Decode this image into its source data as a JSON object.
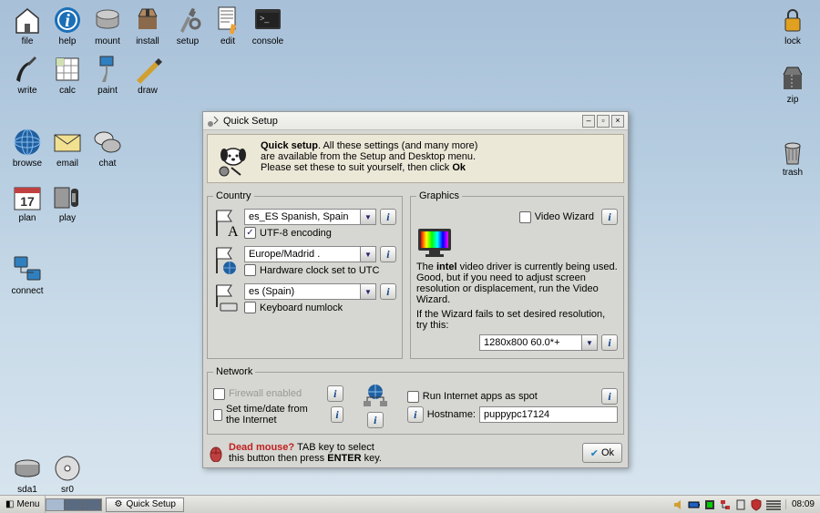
{
  "desktop_icons": {
    "file": "file",
    "help": "help",
    "mount": "mount",
    "install": "install",
    "setup": "setup",
    "edit": "edit",
    "console": "console",
    "write": "write",
    "calc": "calc",
    "paint": "paint",
    "draw": "draw",
    "browse": "browse",
    "email": "email",
    "chat": "chat",
    "plan": "plan",
    "play": "play",
    "connect": "connect",
    "lock": "lock",
    "zip": "zip",
    "trash": "trash",
    "sda1": "sda1",
    "sr0": "sr0"
  },
  "window": {
    "title": "Quick Setup",
    "banner": {
      "line1_bold": "Quick setup",
      "line1_rest": ". All these settings (and many more)",
      "line2": "are available from the Setup and Desktop menu.",
      "line3_pre": "Please set these to suit yourself, then click ",
      "line3_bold": "Ok"
    },
    "country": {
      "legend": "Country",
      "locale": "es_ES       Spanish, Spain",
      "utf8_label": "UTF-8 encoding",
      "utf8_checked": true,
      "timezone": "Europe/Madrid .",
      "hwclock_label": "Hardware clock set to UTC",
      "hwclock_checked": false,
      "keyboard": "es          (Spain)",
      "numlock_label": "Keyboard numlock",
      "numlock_checked": false
    },
    "graphics": {
      "legend": "Graphics",
      "wizard_label": "Video Wizard",
      "para_pre": "The ",
      "para_bold": "intel",
      "para_post": " video driver is currently being used. Good, but if you need to adjust screen resolution or displacement, run the Video Wizard.",
      "para2": "If the Wizard fails to set desired resolution, try this:",
      "resolution": "1280x800        60.0*+"
    },
    "network": {
      "legend": "Network",
      "firewall_label": "Firewall enabled",
      "ntp_label": "Set time/date from the Internet",
      "spot_label": "Run Internet apps as spot",
      "hostname_label": "Hostname:",
      "hostname": "puppypc17124"
    },
    "footer": {
      "dead_mouse": "Dead mouse?",
      "hint1_mid": " TAB key to select",
      "hint2_pre": "this button then press ",
      "hint2_bold": "ENTER",
      "hint2_post": " key.",
      "ok": "Ok"
    }
  },
  "taskbar": {
    "menu": "Menu",
    "task": "Quick Setup",
    "clock": "08:09"
  }
}
